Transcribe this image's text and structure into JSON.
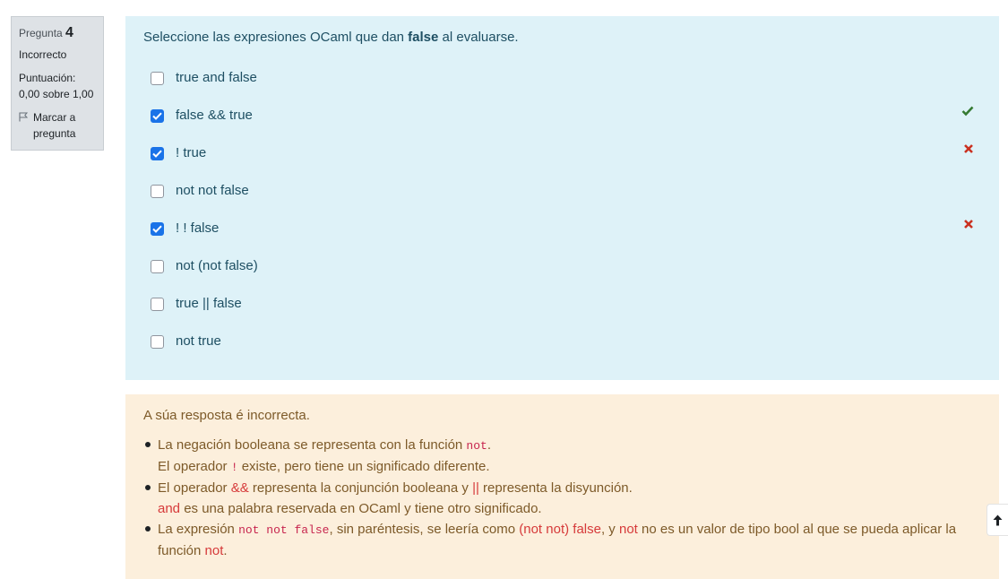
{
  "info": {
    "question_label": "Pregunta",
    "question_number": "4",
    "state": "Incorrecto",
    "grade_label": "Puntuación:",
    "grade_value": "0,00 sobre 1,00",
    "flag_line1": "Marcar a",
    "flag_line2": "pregunta"
  },
  "question": {
    "text_before": "Seleccione las expresiones OCaml que dan ",
    "text_bold": "false",
    "text_after": " al evaluarse.",
    "options": [
      {
        "label": "true and false",
        "checked": false,
        "mark": ""
      },
      {
        "label": "false && true",
        "checked": true,
        "mark": "correct"
      },
      {
        "label": "! true",
        "checked": true,
        "mark": "incorrect"
      },
      {
        "label": "not not false",
        "checked": false,
        "mark": ""
      },
      {
        "label": "! ! false",
        "checked": true,
        "mark": "incorrect"
      },
      {
        "label": "not (not false)",
        "checked": false,
        "mark": ""
      },
      {
        "label": "true || false",
        "checked": false,
        "mark": ""
      },
      {
        "label": "not true",
        "checked": false,
        "mark": ""
      }
    ]
  },
  "feedback": {
    "title": "A súa resposta é incorrecta.",
    "b1_a": "La negación booleana se representa con la función ",
    "b1_code": "not",
    "b1_b": ".",
    "b1_c": "El operador ",
    "b1_code2": "!",
    "b1_d": " existe, pero tiene un significado diferente.",
    "b2_a": "El operador ",
    "b2_kw1": "&&",
    "b2_b": " representa la conjunción booleana y ",
    "b2_kw2": "||",
    "b2_c": " representa la disyunción.",
    "b2_kw3": "and",
    "b2_d": " es una palabra reservada en OCaml y tiene otro significado.",
    "b3_a": "La expresión ",
    "b3_code": "not not false",
    "b3_b": ", sin paréntesis, se leería como ",
    "b3_kw1": "(not not) false",
    "b3_c": ", y ",
    "b3_kw2": "not",
    "b3_d": " no es un valor de tipo bool al que se pueda aplicar la",
    "b3_e": "función ",
    "b3_kw3": "not",
    "b3_f": "."
  },
  "colors": {
    "question_bg": "#def2f8",
    "feedback_bg": "#fcefdc",
    "checkbox_checked": "#1a73e8",
    "correct": "#357a32",
    "incorrect": "#ca3120"
  },
  "icons": {
    "flag": "flag-icon",
    "correct": "check-icon",
    "incorrect": "cross-icon",
    "back_to_top": "arrow-up-icon"
  }
}
